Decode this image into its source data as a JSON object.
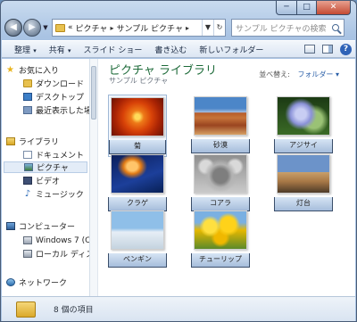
{
  "window": {
    "caption_buttons": {
      "minimize": "─",
      "maximize": "□",
      "close": "✕"
    }
  },
  "address": {
    "back": "◀",
    "forward": "▶",
    "overflow": "«",
    "crumbs": [
      "ピクチャ",
      "サンプル ピクチャ"
    ],
    "separator": "▸"
  },
  "search": {
    "placeholder": "サンプル ピクチャの検索"
  },
  "toolbar": {
    "items": [
      {
        "label": "整理",
        "has_dropdown": true
      },
      {
        "label": "共有",
        "has_dropdown": true
      },
      {
        "label": "スライド ショー",
        "has_dropdown": false
      },
      {
        "label": "書き込む",
        "has_dropdown": false
      },
      {
        "label": "新しいフォルダー",
        "has_dropdown": false
      }
    ],
    "help": "?"
  },
  "nav": {
    "items": [
      {
        "label": "お気に入り",
        "icon": "star-icon",
        "level": "top"
      },
      {
        "label": "ダウンロード",
        "icon": "downloads-folder-icon",
        "level": "sub"
      },
      {
        "label": "デスクトップ",
        "icon": "desktop-icon",
        "level": "sub"
      },
      {
        "label": "最近表示した場所",
        "icon": "recent-places-icon",
        "level": "sub"
      },
      {
        "label": "ライブラリ",
        "icon": "library-icon",
        "level": "top"
      },
      {
        "label": "ドキュメント",
        "icon": "documents-icon",
        "level": "sub"
      },
      {
        "label": "ピクチャ",
        "icon": "pictures-icon",
        "level": "sub",
        "selected": true
      },
      {
        "label": "ビデオ",
        "icon": "videos-icon",
        "level": "sub"
      },
      {
        "label": "ミュージック",
        "icon": "music-icon",
        "level": "sub"
      },
      {
        "label": "コンピューター",
        "icon": "computer-icon",
        "level": "top"
      },
      {
        "label": "Windows 7 (C:)",
        "icon": "drive-icon",
        "level": "sub"
      },
      {
        "label": "ローカル ディス",
        "icon": "drive-icon",
        "level": "sub"
      },
      {
        "label": "ネットワーク",
        "icon": "network-icon",
        "level": "top"
      }
    ]
  },
  "content": {
    "library_title": "ピクチャ ライブラリ",
    "library_subtitle": "サンプル ピクチャ",
    "arrange_label": "並べ替え:",
    "arrange_value": "フォルダー ▾",
    "items": [
      {
        "caption": "菊",
        "picture": "chrysanthemum",
        "selected": true
      },
      {
        "caption": "砂漠",
        "picture": "desert"
      },
      {
        "caption": "アジサイ",
        "picture": "hydrangeas"
      },
      {
        "caption": "クラゲ",
        "picture": "jellyfish"
      },
      {
        "caption": "コアラ",
        "picture": "koala"
      },
      {
        "caption": "灯台",
        "picture": "lighthouse"
      },
      {
        "caption": "ペンギン",
        "picture": "penguins"
      },
      {
        "caption": "チューリップ",
        "picture": "tulips"
      }
    ]
  },
  "details": {
    "count_text": "8 個の項目"
  },
  "colors": {
    "library_title": "#1e6b3a",
    "link_blue": "#2b5fa8",
    "close_red": "#c44a33"
  }
}
